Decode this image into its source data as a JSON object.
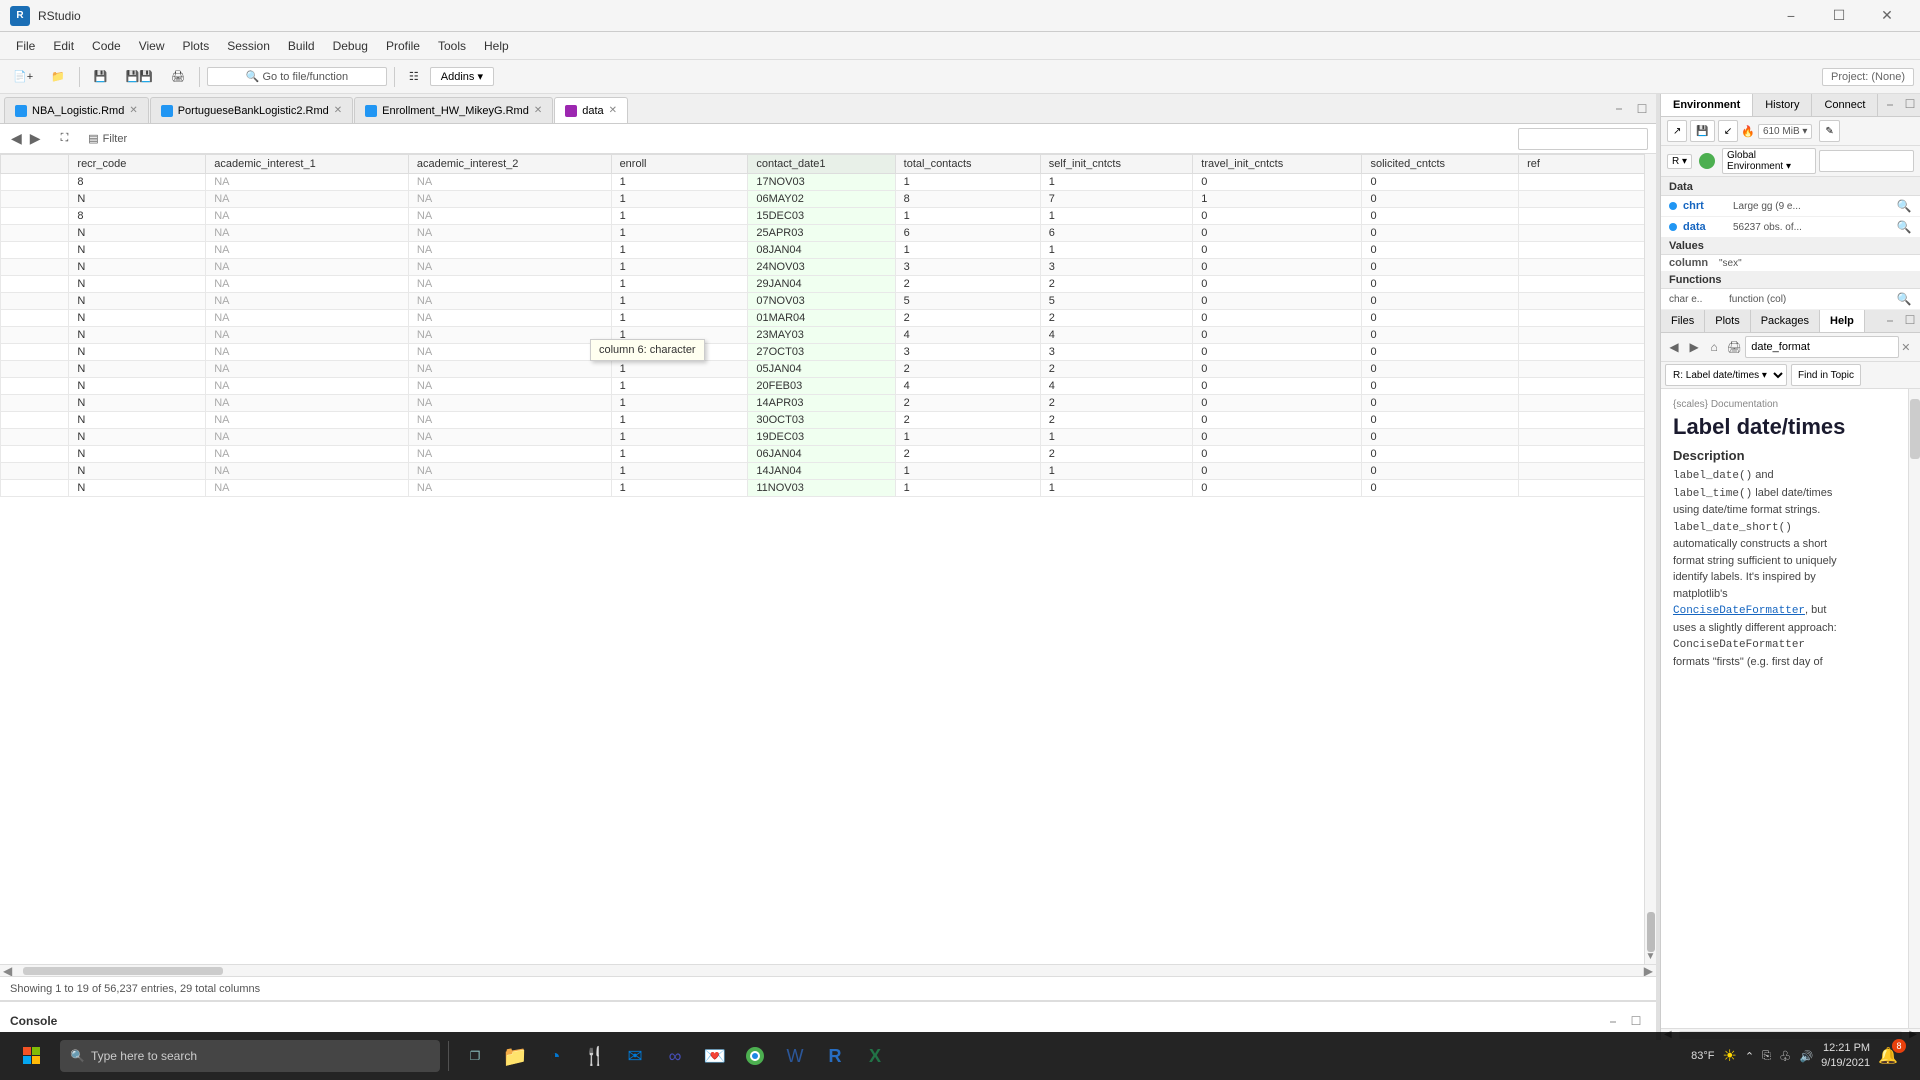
{
  "app": {
    "title": "RStudio",
    "project": "Project: (None)"
  },
  "title_bar": {
    "title": "RStudio"
  },
  "menu": {
    "items": [
      "File",
      "Edit",
      "Code",
      "View",
      "Plots",
      "Session",
      "Build",
      "Debug",
      "Profile",
      "Tools",
      "Help"
    ]
  },
  "toolbar": {
    "go_to_placeholder": "Go to file/function",
    "addins_label": "Addins ▾",
    "project_label": "Project: (None)"
  },
  "tabs": [
    {
      "label": "NBA_Logistic.Rmd",
      "type": "rmd",
      "active": false
    },
    {
      "label": "PortugueseBankLogistic2.Rmd",
      "type": "rmd",
      "active": false
    },
    {
      "label": "Enrollment_HW_MikeyG.Rmd",
      "type": "rmd",
      "active": false
    },
    {
      "label": "data",
      "type": "data",
      "active": true
    }
  ],
  "data_toolbar": {
    "filter_label": "Filter",
    "search_placeholder": ""
  },
  "table": {
    "columns": [
      {
        "name": "",
        "type": "",
        "key": "rownum"
      },
      {
        "name": "recr_code",
        "type": "",
        "key": "recr_code"
      },
      {
        "name": "academic_interest_1",
        "type": "",
        "key": "ai1"
      },
      {
        "name": "academic_interest_2",
        "type": "",
        "key": "ai2"
      },
      {
        "name": "enroll",
        "type": "",
        "key": "enroll"
      },
      {
        "name": "contact_date1",
        "type": "",
        "key": "cd1"
      },
      {
        "name": "total_contacts",
        "type": "",
        "key": "tc"
      },
      {
        "name": "self_init_cntcts",
        "type": "",
        "key": "sic"
      },
      {
        "name": "travel_init_cntcts",
        "type": "",
        "key": "tic"
      },
      {
        "name": "solicited_cntcts",
        "type": "",
        "key": "sc"
      },
      {
        "name": "ref",
        "type": "",
        "key": "ref"
      }
    ],
    "rows": [
      {
        "rownum": "",
        "recr_code": "8",
        "ai1": "NA",
        "ai2": "NA",
        "enroll": "1",
        "cd1": "17NOV03",
        "tc": "1",
        "sic": "1",
        "tic": "0",
        "sc": "0",
        "ref": ""
      },
      {
        "rownum": "",
        "recr_code": "N",
        "ai1": "NA",
        "ai2": "NA",
        "enroll": "1",
        "cd1": "06MAY02",
        "tc": "8",
        "sic": "7",
        "tic": "1",
        "sc": "0",
        "ref": ""
      },
      {
        "rownum": "",
        "recr_code": "8",
        "ai1": "NA",
        "ai2": "NA",
        "enroll": "1",
        "cd1": "15DEC03",
        "tc": "1",
        "sic": "1",
        "tic": "0",
        "sc": "0",
        "ref": ""
      },
      {
        "rownum": "",
        "recr_code": "N",
        "ai1": "NA",
        "ai2": "NA",
        "enroll": "1",
        "cd1": "25APR03",
        "tc": "6",
        "sic": "6",
        "tic": "0",
        "sc": "0",
        "ref": ""
      },
      {
        "rownum": "",
        "recr_code": "N",
        "ai1": "NA",
        "ai2": "NA",
        "enroll": "1",
        "cd1": "08JAN04",
        "tc": "1",
        "sic": "1",
        "tic": "0",
        "sc": "0",
        "ref": ""
      },
      {
        "rownum": "",
        "recr_code": "N",
        "ai1": "NA",
        "ai2": "NA",
        "enroll": "1",
        "cd1": "24NOV03",
        "tc": "3",
        "sic": "3",
        "tic": "0",
        "sc": "0",
        "ref": ""
      },
      {
        "rownum": "",
        "recr_code": "N",
        "ai1": "NA",
        "ai2": "NA",
        "enroll": "1",
        "cd1": "29JAN04",
        "tc": "2",
        "sic": "2",
        "tic": "0",
        "sc": "0",
        "ref": ""
      },
      {
        "rownum": "",
        "recr_code": "N",
        "ai1": "NA",
        "ai2": "NA",
        "enroll": "1",
        "cd1": "07NOV03",
        "tc": "5",
        "sic": "5",
        "tic": "0",
        "sc": "0",
        "ref": ""
      },
      {
        "rownum": "",
        "recr_code": "N",
        "ai1": "NA",
        "ai2": "NA",
        "enroll": "1",
        "cd1": "01MAR04",
        "tc": "2",
        "sic": "2",
        "tic": "0",
        "sc": "0",
        "ref": ""
      },
      {
        "rownum": "",
        "recr_code": "N",
        "ai1": "NA",
        "ai2": "NA",
        "enroll": "1",
        "cd1": "23MAY03",
        "tc": "4",
        "sic": "4",
        "tic": "0",
        "sc": "0",
        "ref": ""
      },
      {
        "rownum": "",
        "recr_code": "N",
        "ai1": "NA",
        "ai2": "NA",
        "enroll": "1",
        "cd1": "27OCT03",
        "tc": "3",
        "sic": "3",
        "tic": "0",
        "sc": "0",
        "ref": ""
      },
      {
        "rownum": "",
        "recr_code": "N",
        "ai1": "NA",
        "ai2": "NA",
        "enroll": "1",
        "cd1": "05JAN04",
        "tc": "2",
        "sic": "2",
        "tic": "0",
        "sc": "0",
        "ref": ""
      },
      {
        "rownum": "",
        "recr_code": "N",
        "ai1": "NA",
        "ai2": "NA",
        "enroll": "1",
        "cd1": "20FEB03",
        "tc": "4",
        "sic": "4",
        "tic": "0",
        "sc": "0",
        "ref": ""
      },
      {
        "rownum": "",
        "recr_code": "N",
        "ai1": "NA",
        "ai2": "NA",
        "enroll": "1",
        "cd1": "14APR03",
        "tc": "2",
        "sic": "2",
        "tic": "0",
        "sc": "0",
        "ref": ""
      },
      {
        "rownum": "",
        "recr_code": "N",
        "ai1": "NA",
        "ai2": "NA",
        "enroll": "1",
        "cd1": "30OCT03",
        "tc": "2",
        "sic": "2",
        "tic": "0",
        "sc": "0",
        "ref": ""
      },
      {
        "rownum": "",
        "recr_code": "N",
        "ai1": "NA",
        "ai2": "NA",
        "enroll": "1",
        "cd1": "19DEC03",
        "tc": "1",
        "sic": "1",
        "tic": "0",
        "sc": "0",
        "ref": ""
      },
      {
        "rownum": "",
        "recr_code": "N",
        "ai1": "NA",
        "ai2": "NA",
        "enroll": "1",
        "cd1": "06JAN04",
        "tc": "2",
        "sic": "2",
        "tic": "0",
        "sc": "0",
        "ref": ""
      },
      {
        "rownum": "",
        "recr_code": "N",
        "ai1": "NA",
        "ai2": "NA",
        "enroll": "1",
        "cd1": "14JAN04",
        "tc": "1",
        "sic": "1",
        "tic": "0",
        "sc": "0",
        "ref": ""
      },
      {
        "rownum": "",
        "recr_code": "N",
        "ai1": "NA",
        "ai2": "NA",
        "enroll": "1",
        "cd1": "11NOV03",
        "tc": "1",
        "sic": "1",
        "tic": "0",
        "sc": "0",
        "ref": ""
      }
    ],
    "status": "Showing 1 to 19 of 56,237 entries, 29 total columns"
  },
  "tooltip": {
    "text": "column 6: character"
  },
  "console": {
    "label": "Console"
  },
  "right_panel": {
    "env_tabs": [
      "Environment",
      "History",
      "Connect"
    ],
    "env_toolbar": {
      "memory": "610 MiB ▾",
      "r_label": "R ▾",
      "global_label": "Global Environment ▾"
    },
    "data_section": "Data",
    "data_items": [
      {
        "name": "chrt",
        "value": "Large gg (9 e...",
        "has_view": true
      },
      {
        "name": "data",
        "value": "56237 obs. of...",
        "has_view": true
      }
    ],
    "values_section": "Values",
    "values_items": [
      {
        "name": "column",
        "value": "\"sex\""
      }
    ],
    "functions_section": "Functions",
    "functions_items": [
      {
        "name": "char e..",
        "value": "function (col)"
      }
    ],
    "files_tabs": [
      "Files",
      "Plots",
      "Packages",
      "Help"
    ],
    "help_toolbar": {
      "search_value": "date_format",
      "find_topic": "Find in Topic",
      "r_select": "R: Label date/times ▾"
    },
    "help_breadcrumb": "{scales} Documentation",
    "help_title": "Label date/times",
    "help_description_title": "Description",
    "help_text_1": "label_date() and",
    "help_text_2": "label_time() label date/times using date/time format strings.",
    "help_text_3": "label_date_short() automatically constructs a short format string sufficient to uniquely identify labels. It's inspired by matplotlib's",
    "help_link": "ConciseDateFormatter",
    "help_text_4": ", but uses a slightly different approach: ConciseDateFormatter formats \"firsts\" (e.g. first day of"
  },
  "taskbar": {
    "search_placeholder": "Type here to search",
    "time": "12:21 PM",
    "date": "9/19/2021",
    "temperature": "83°F",
    "notification_count": "8"
  }
}
